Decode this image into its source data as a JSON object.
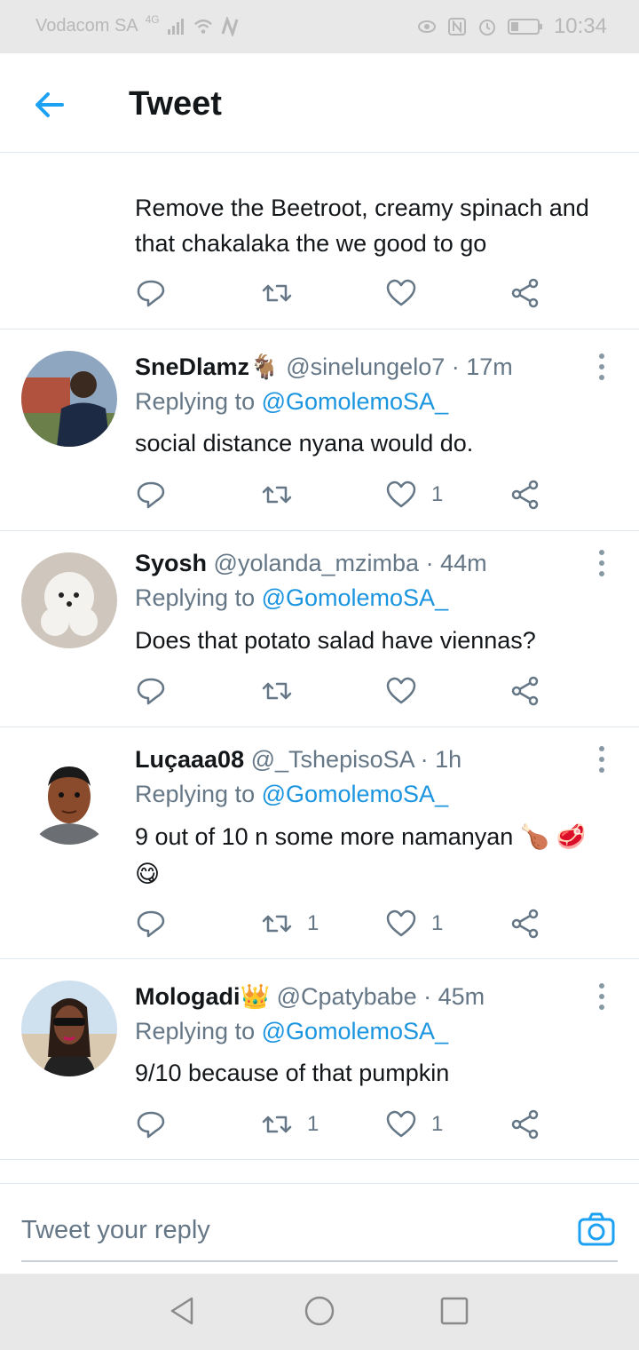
{
  "status_bar": {
    "carrier": "Vodacom SA",
    "network": "4G",
    "time": "10:34"
  },
  "header": {
    "title": "Tweet"
  },
  "top_tweet": {
    "text": "Remove the Beetroot, creamy spinach and that chakalaka the we good to go"
  },
  "replies": [
    {
      "name": "SneDlamz",
      "name_emoji": "🐐",
      "handle": "@sinelungelo7",
      "time": "· 17m",
      "replying_prefix": "Replying to ",
      "replying_to": "@GomolemoSA_",
      "text": "social distance nyana would do.",
      "retweets": "",
      "likes": "1"
    },
    {
      "name": "Syosh",
      "name_emoji": "",
      "handle": "@yolanda_mzimba",
      "time": "· 44m",
      "replying_prefix": "Replying to ",
      "replying_to": "@GomolemoSA_",
      "text": "Does that potato salad have viennas?",
      "retweets": "",
      "likes": ""
    },
    {
      "name": "Luçaaa08",
      "name_emoji": "",
      "handle": "@_TshepisoSA",
      "time": "· 1h",
      "replying_prefix": "Replying to ",
      "replying_to": "@GomolemoSA_",
      "text": "9 out of 10 n some more namanyan 🍗 🥩😋",
      "retweets": "1",
      "likes": "1"
    },
    {
      "name": "Mologadi",
      "name_emoji": "👑",
      "handle": "@Cpatybabe",
      "time": "· 45m",
      "replying_prefix": "Replying to ",
      "replying_to": "@GomolemoSA_",
      "text": "9/10 because of that pumpkin",
      "retweets": "1",
      "likes": "1"
    }
  ],
  "reply_bar": {
    "placeholder": "Tweet your reply"
  },
  "colors": {
    "accent": "#1da1f2",
    "mention": "#1b95e0",
    "secondary_text": "#657786",
    "divider": "#e1e8ed"
  },
  "icons": [
    "back-arrow-icon",
    "reply-icon",
    "retweet-icon",
    "like-icon",
    "share-icon",
    "more-icon",
    "camera-icon",
    "nav-back-icon",
    "nav-home-icon",
    "nav-recents-icon"
  ]
}
